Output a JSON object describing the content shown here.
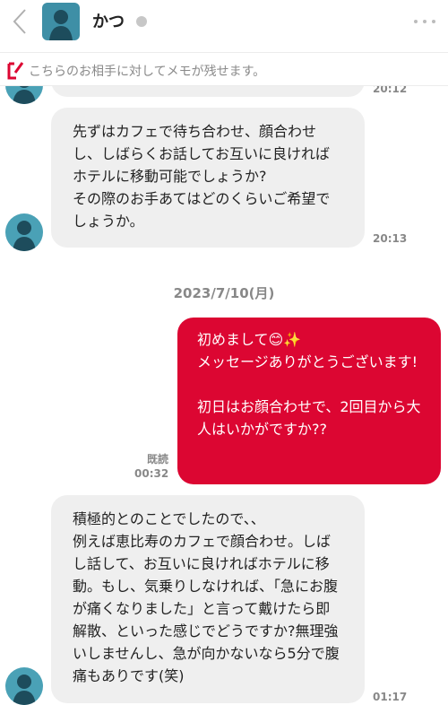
{
  "header": {
    "name": "かつ",
    "status_color": "#c7c7c7"
  },
  "memo": {
    "text": "こちらのお相手に対してメモが残せます。"
  },
  "messages": [
    {
      "side": "in",
      "text": "",
      "time": "20:12"
    },
    {
      "side": "in",
      "text": "先ずはカフェで待ち合わせ、顔合わせし、しばらくお話してお互いに良ければホテルに移動可能でしょうか?\nその際のお手あてはどのくらいご希望でしょうか。",
      "time": "20:13"
    },
    {
      "side": "date",
      "text": "2023/7/10(月)"
    },
    {
      "side": "out",
      "text": "初めまして😊✨\nメッセージありがとうございます!\n\n初日はお顔合わせで、2回目から大人はいかがですか??",
      "read": "既読",
      "time": "00:32"
    },
    {
      "side": "in",
      "text": "積極的とのことでしたので、、\n例えば恵比寿のカフェで顔合わせ。しばし話して、お互いに良ければホテルに移動。もし、気乗りしなければ、「急にお腹が痛くなりました」と言って戴けたら即解散、といった感じでどうですか?無理強いしませんし、急が向かないなら5分で腹痛もありです(笑)",
      "time": "01:17"
    }
  ],
  "colors": {
    "accent": "#dc0632",
    "incoming_bubble": "#efefef"
  }
}
